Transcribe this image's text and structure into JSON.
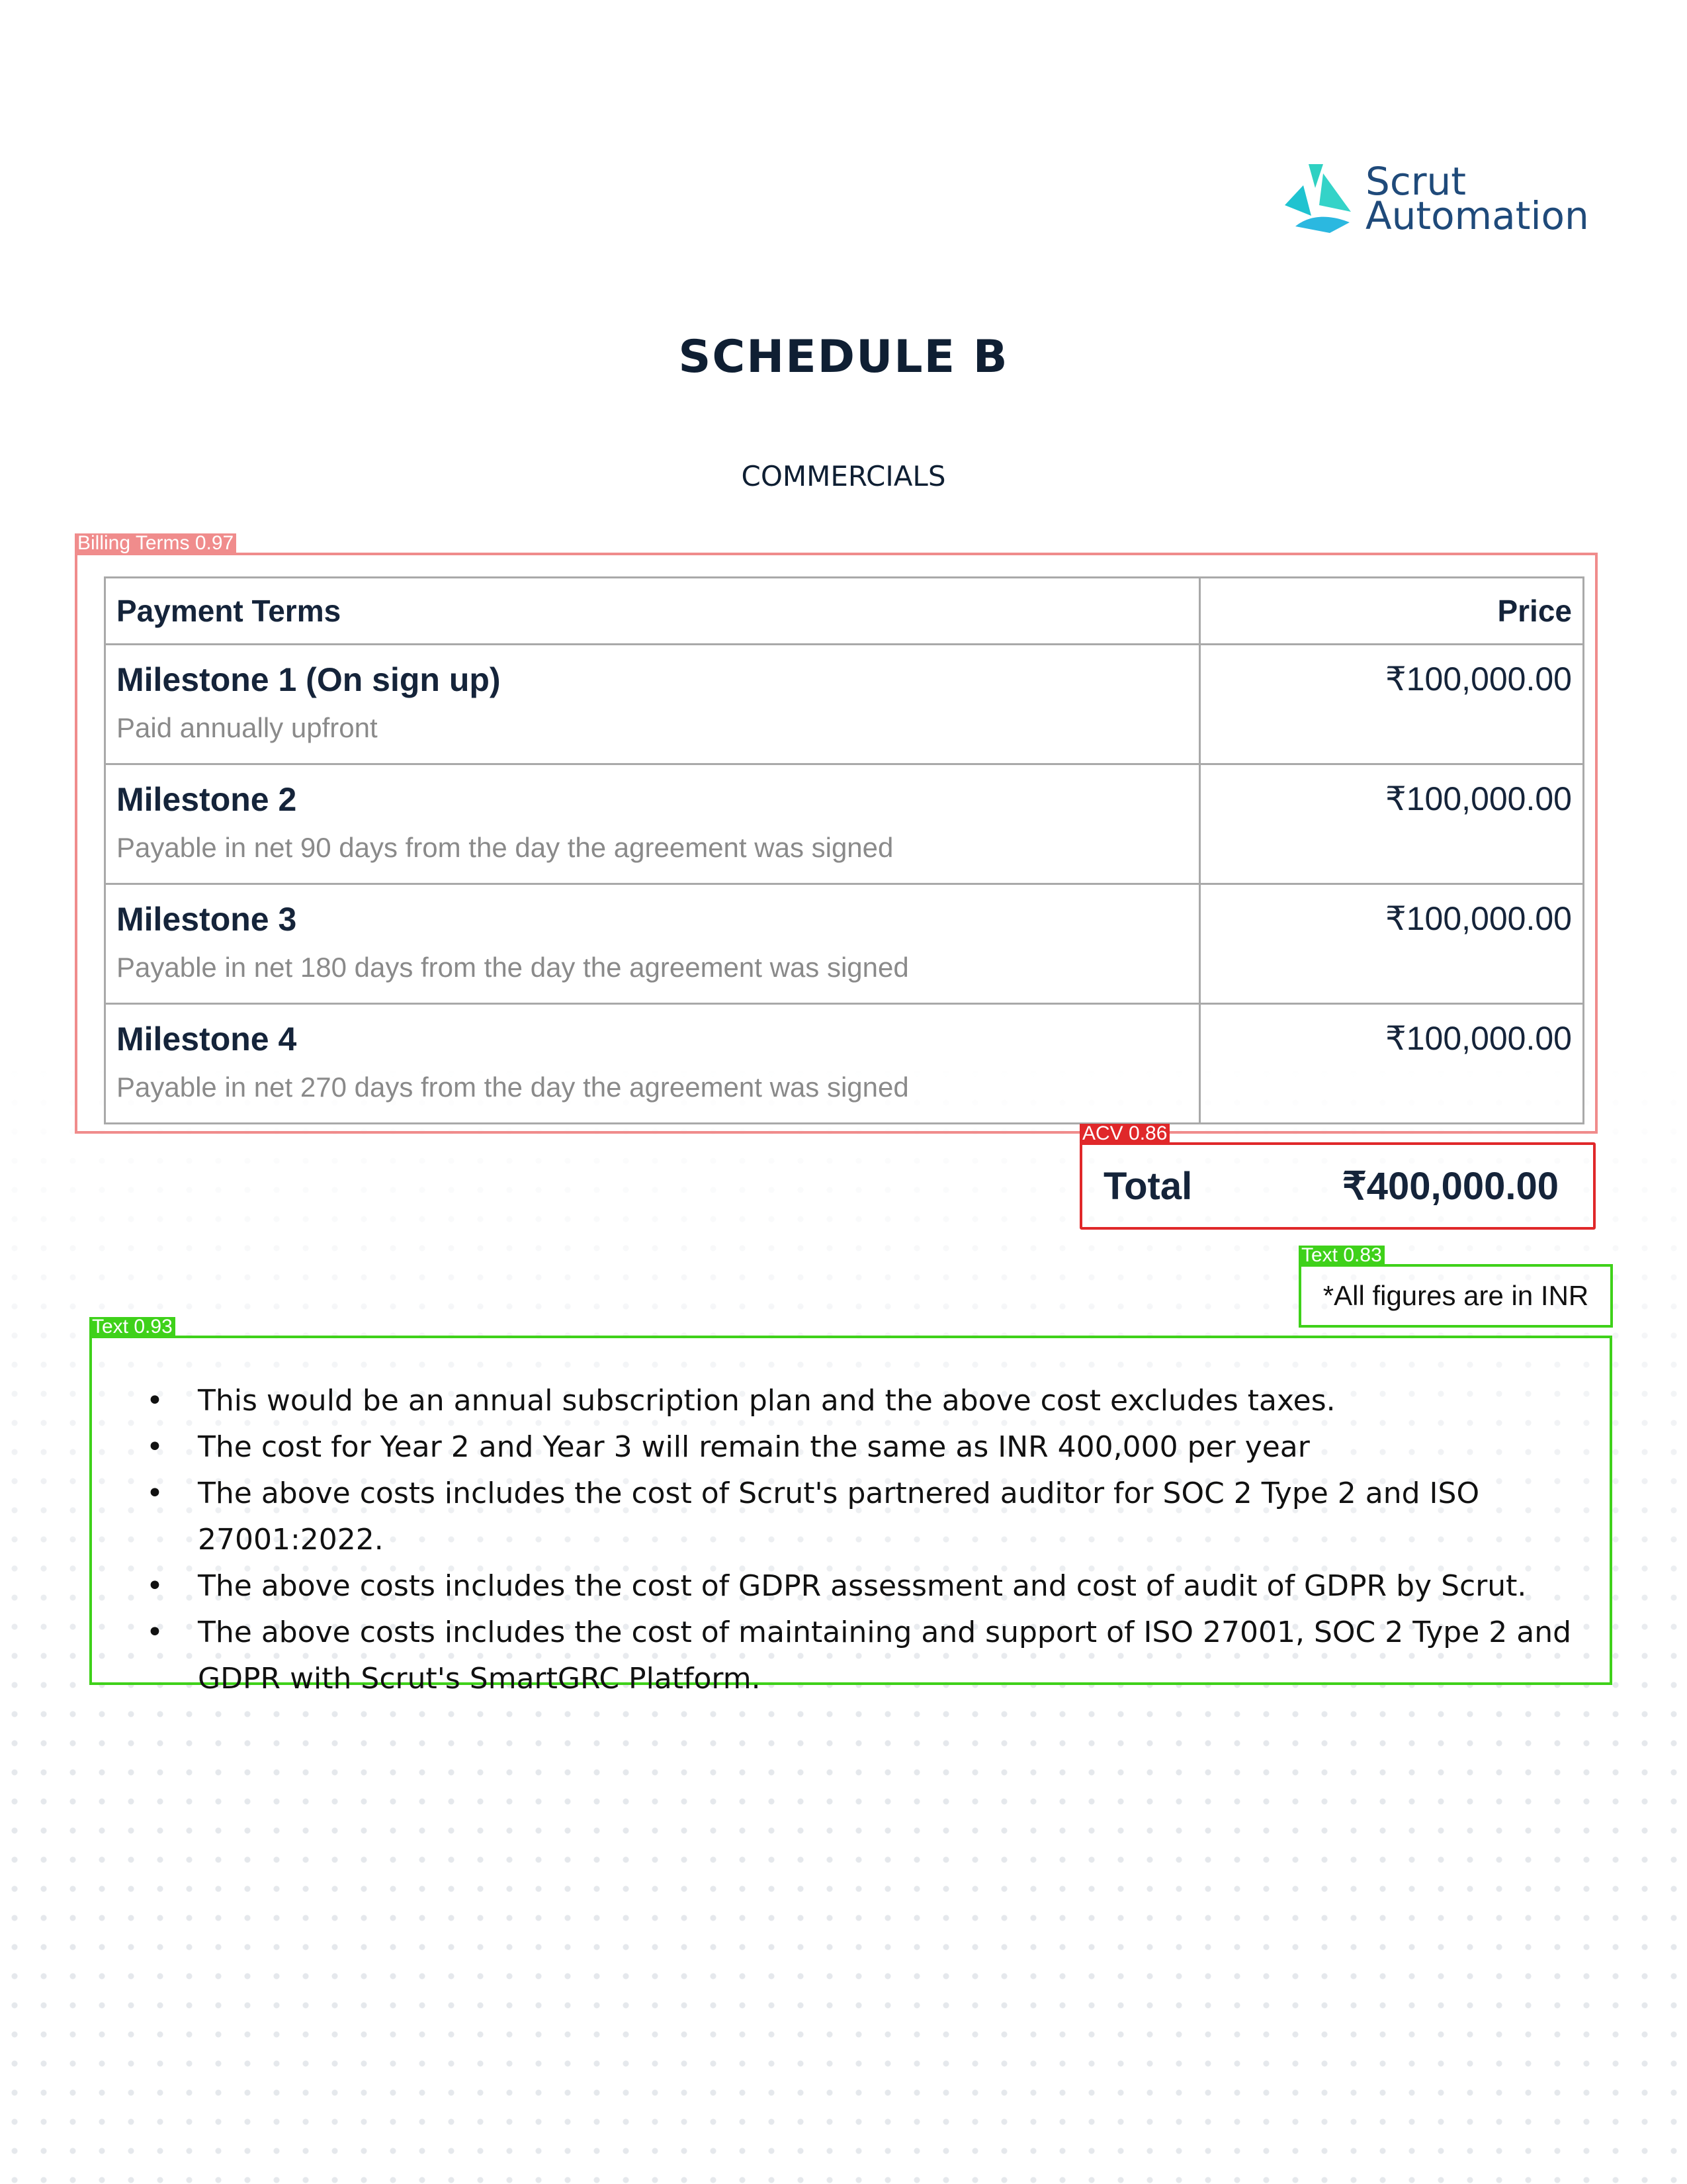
{
  "logo": {
    "line1": "Scrut",
    "line2": "Automation",
    "icon": "scrut-triangle-logo-icon",
    "colors": {
      "teal": "#2fd1c2",
      "blue": "#1f4a7a"
    }
  },
  "header": {
    "title": "SCHEDULE B",
    "subtitle": "COMMERCIALS"
  },
  "detections": {
    "billing_terms": {
      "label": "Billing Terms",
      "score": "0.97",
      "color": "#f08c8c"
    },
    "acv": {
      "label": "ACV",
      "score": "0.86",
      "color": "#e0282a"
    },
    "note_text": {
      "label": "Text",
      "score": "0.83",
      "color": "#3fd11a"
    },
    "bullets_text": {
      "label": "Text",
      "score": "0.93",
      "color": "#3fd11a"
    }
  },
  "table": {
    "headers": {
      "terms": "Payment Terms",
      "price": "Price"
    },
    "rows": [
      {
        "title": "Milestone 1 (On sign up)",
        "subtitle": "Paid annually upfront",
        "price": "₹100,000.00"
      },
      {
        "title": "Milestone 2",
        "subtitle": "Payable in net 90 days from the day the agreement was signed",
        "price": "₹100,000.00"
      },
      {
        "title": "Milestone 3",
        "subtitle": "Payable in net 180 days from the day the agreement was signed",
        "price": "₹100,000.00"
      },
      {
        "title": "Milestone 4",
        "subtitle": "Payable in net 270 days from the day the agreement was signed",
        "price": "₹100,000.00"
      }
    ]
  },
  "total": {
    "label": "Total",
    "value": "₹400,000.00"
  },
  "note": "*All figures are in INR",
  "bullets": [
    "This would be an annual subscription plan and the above cost excludes taxes.",
    "The cost for Year 2 and Year 3 will remain the same as INR 400,000 per year",
    "The above costs includes the cost of Scrut's partnered auditor for SOC 2 Type 2 and ISO 27001:2022.",
    "The above costs includes the cost of GDPR assessment and cost of audit of GDPR by Scrut.",
    "The above costs includes the cost of maintaining and support of ISO 27001, SOC 2 Type 2 and GDPR with Scrut's SmartGRC Platform."
  ]
}
